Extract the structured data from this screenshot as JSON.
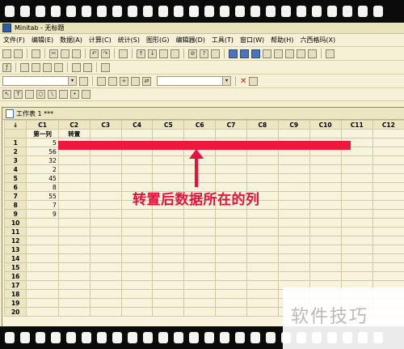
{
  "window": {
    "title": "Minitab - 无标题"
  },
  "menu": [
    "文件(F)",
    "编辑(E)",
    "数据(A)",
    "计算(C)",
    "统计(S)",
    "图形(G)",
    "编辑器(D)",
    "工具(T)",
    "窗口(W)",
    "帮助(H)",
    "六西格玛(X)"
  ],
  "worksheet": {
    "title": "工作表 1 ***",
    "columns": [
      "C1",
      "C2",
      "C3",
      "C4",
      "C5",
      "C6",
      "C7",
      "C8",
      "C9",
      "C10",
      "C11",
      "C12"
    ],
    "column_names": [
      "第一列",
      "转置",
      "",
      "",
      "",
      "",
      "",
      "",
      "",
      "",
      "",
      ""
    ],
    "rows": [
      "1",
      "2",
      "3",
      "4",
      "5",
      "6",
      "7",
      "8",
      "9",
      "10",
      "11",
      "12",
      "13",
      "14",
      "15",
      "16",
      "17",
      "18",
      "19",
      "20"
    ],
    "c1_values": [
      "5",
      "56",
      "32",
      "2",
      "45",
      "8",
      "55",
      "7",
      "9",
      "",
      "",
      "",
      "",
      "",
      "",
      "",
      "",
      "",
      "",
      ""
    ]
  },
  "annotation": {
    "text": "转置后数据所在的列",
    "color": "#e8113d"
  },
  "watermark": {
    "text": "软件技巧"
  }
}
